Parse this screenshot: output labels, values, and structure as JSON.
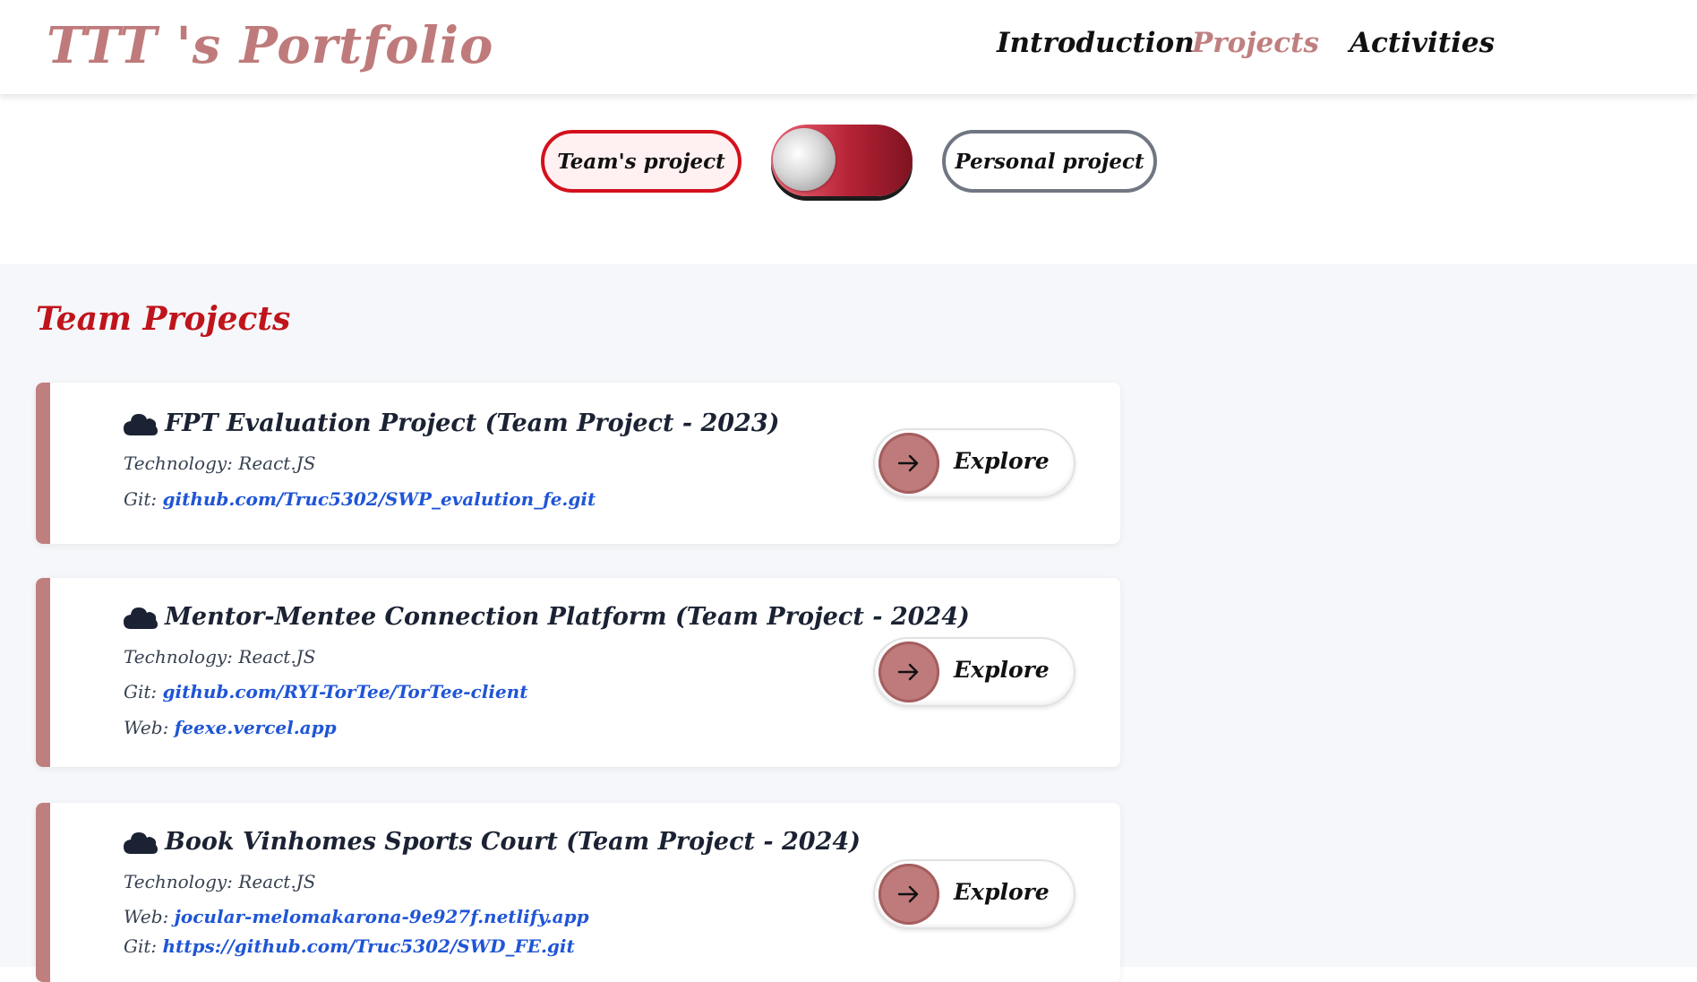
{
  "header": {
    "logo": "TTT 's Portfolio",
    "nav": [
      {
        "label": "Introduction",
        "active": false
      },
      {
        "label": "Projects",
        "active": true
      },
      {
        "label": "Activities",
        "active": false
      }
    ]
  },
  "toggle": {
    "team_label": "Team's project",
    "personal_label": "Personal project"
  },
  "section": {
    "title": "Team Projects"
  },
  "projects": [
    {
      "icon": "cloud-icon",
      "title": "FPT Evaluation Project (Team Project - 2023)",
      "lines": [
        {
          "label": "Technology:",
          "value": "React.JS"
        },
        {
          "label": "Git:",
          "link": "github.com/Truc5302/SWP_evalution_fe.git"
        }
      ],
      "button": "Explore"
    },
    {
      "icon": "cloud-icon",
      "title": "Mentor-Mentee Connection Platform (Team Project - 2024)",
      "lines": [
        {
          "label": "Technology:",
          "value": "React.JS"
        },
        {
          "label": "Git:",
          "link": "github.com/RYI-TorTee/TorTee-client"
        },
        {
          "label": "Web:",
          "link": "feexe.vercel.app"
        }
      ],
      "button": "Explore"
    },
    {
      "icon": "cloud-icon",
      "title": "Book Vinhomes Sports Court (Team Project - 2024)",
      "lines": [
        {
          "label": "Technology:",
          "value": "React.JS"
        },
        {
          "label": "Web:",
          "link": "jocular-melomakarona-9e927f.netlify.app"
        },
        {
          "label": "Git:",
          "link": "https://github.com/Truc5302/SWD_FE.git"
        }
      ],
      "button": "Explore"
    }
  ],
  "colors": {
    "accent": "#c07f7f",
    "team_red": "#c0141c",
    "link": "#1f55d6"
  }
}
